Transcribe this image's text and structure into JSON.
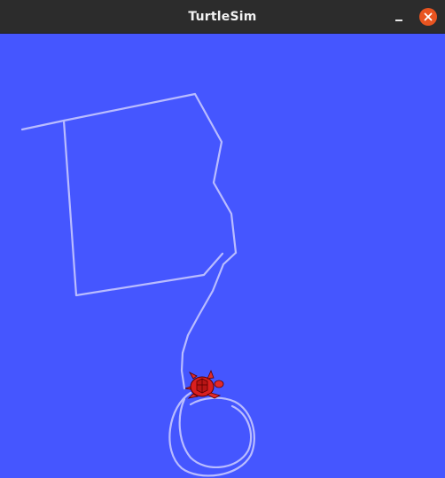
{
  "window": {
    "title": "TurtleSim"
  },
  "titlebar": {
    "minimize_icon": "minimize-icon",
    "close_icon": "close-icon",
    "close_color": "#e95420"
  },
  "canvas": {
    "background_color": "#4556ff",
    "pen_color": "#b3b8ff",
    "turtle_color": "#e02020"
  }
}
